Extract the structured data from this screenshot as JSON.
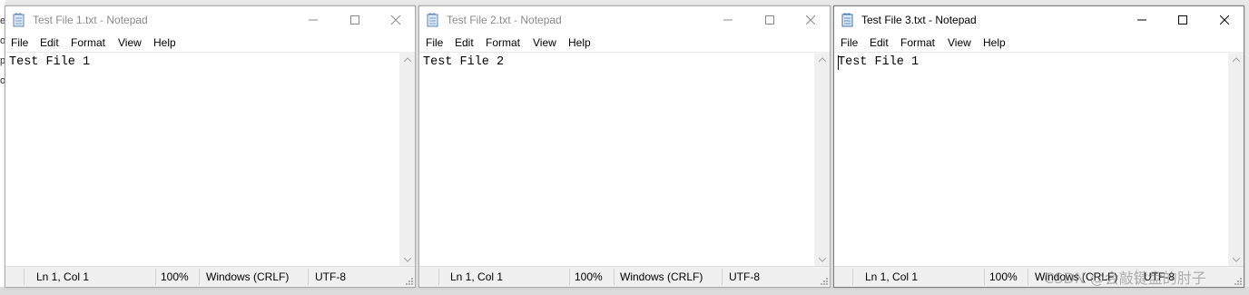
{
  "background": {
    "left_edge_text": [
      "e",
      "ol",
      "p",
      "o"
    ]
  },
  "windows": [
    {
      "title": "Test File 1.txt - Notepad",
      "active": false,
      "menu": [
        "File",
        "Edit",
        "Format",
        "View",
        "Help"
      ],
      "content": "Test File 1",
      "status": {
        "position": "Ln 1, Col 1",
        "zoom": "100%",
        "line_endings": "Windows (CRLF)",
        "encoding": "UTF-8"
      }
    },
    {
      "title": "Test File 2.txt - Notepad",
      "active": false,
      "menu": [
        "File",
        "Edit",
        "Format",
        "View",
        "Help"
      ],
      "content": "Test File 2",
      "status": {
        "position": "Ln 1, Col 1",
        "zoom": "100%",
        "line_endings": "Windows (CRLF)",
        "encoding": "UTF-8"
      }
    },
    {
      "title": "Test File 3.txt - Notepad",
      "active": true,
      "menu": [
        "File",
        "Edit",
        "Format",
        "View",
        "Help"
      ],
      "content": "Test File 1",
      "status": {
        "position": "Ln 1, Col 1",
        "zoom": "100%",
        "line_endings": "Windows (CRLF)",
        "encoding": "UTF-8"
      }
    }
  ],
  "watermark": "CSDN @会敲键盘的肘子",
  "icons": {
    "app": "notepad-icon",
    "minimize": "minimize-icon",
    "maximize": "maximize-icon",
    "close": "close-icon"
  }
}
